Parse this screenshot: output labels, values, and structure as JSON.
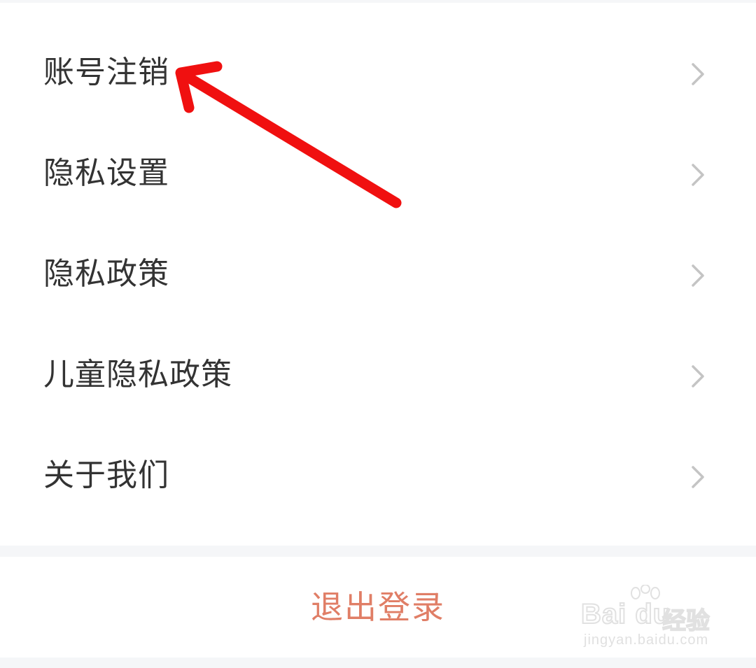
{
  "menu": {
    "items": [
      {
        "label": "账号注销",
        "icon": "chevron-right-icon"
      },
      {
        "label": "隐私设置",
        "icon": "chevron-right-icon"
      },
      {
        "label": "隐私政策",
        "icon": "chevron-right-icon"
      },
      {
        "label": "儿童隐私政策",
        "icon": "chevron-right-icon"
      },
      {
        "label": "关于我们",
        "icon": "chevron-right-icon"
      }
    ]
  },
  "logout": {
    "label": "退出登录",
    "color": "#e07e66"
  },
  "annotation": {
    "icon": "red-arrow-annotation",
    "color": "#f01010"
  },
  "watermark": {
    "brand": "Bai du",
    "product": "经验",
    "url": "jingyan.baidu.com"
  },
  "colors": {
    "text": "#333333",
    "chevron": "#c4c4c4",
    "separator": "#f5f6f8"
  }
}
